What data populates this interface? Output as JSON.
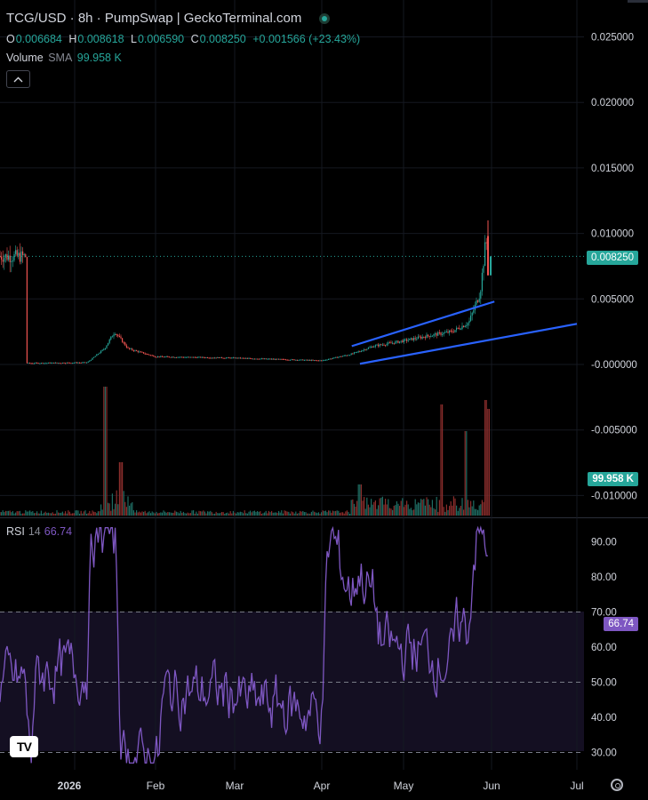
{
  "header": {
    "title": "TCG/USD · 8h · PumpSwap | GeckoTerminal.com",
    "ohlc": [
      {
        "key": "O",
        "value": "0.006684"
      },
      {
        "key": "H",
        "value": "0.008618"
      },
      {
        "key": "L",
        "value": "0.006590"
      },
      {
        "key": "C",
        "value": "0.008250"
      }
    ],
    "change": "+0.001566 (+23.43%)",
    "volume_label": "Volume",
    "volume_sma": "SMA",
    "volume_value": "99.958 K",
    "collapse_icon": "chevron-up-icon"
  },
  "rsi_header": {
    "label": "RSI",
    "period": "14",
    "value": "66.74"
  },
  "price_tag": "0.008250",
  "volume_tag": "99.958 K",
  "rsi_tag": "66.74",
  "colors": {
    "up": "#26a69a",
    "down": "#ef5350",
    "rsi": "#7e57c2",
    "trendline": "#2962ff"
  },
  "chart_data": {
    "type": "candlestick",
    "title": "TCG/USD · 8h · PumpSwap | GeckoTerminal.com",
    "x_ticks": [
      "2026",
      "Feb",
      "Mar",
      "Apr",
      "May",
      "Jun",
      "Jul"
    ],
    "y_ticks_price": [
      "0.025000",
      "0.020000",
      "0.015000",
      "0.010000",
      "0.005000",
      "-0.000000",
      "-0.005000",
      "-0.010000"
    ],
    "y_ticks_rsi": [
      "90.00",
      "80.00",
      "70.00",
      "60.00",
      "50.00",
      "40.00",
      "30.00"
    ],
    "last_price": 0.00825,
    "price_path": [
      [
        "Dec 20",
        0.0001
      ],
      [
        "Jan 12",
        0.00015
      ],
      [
        "Jan 17",
        0.0012
      ],
      [
        "Jan 20",
        0.0025
      ],
      [
        "Jan 24",
        0.0012
      ],
      [
        "Feb 1",
        0.0006
      ],
      [
        "Mar 1",
        0.0005
      ],
      [
        "Apr 1",
        0.0003
      ],
      [
        "Apr 12",
        0.0008
      ],
      [
        "Apr 20",
        0.0014
      ],
      [
        "May 1",
        0.0018
      ],
      [
        "May 10",
        0.0022
      ],
      [
        "May 18",
        0.0025
      ],
      [
        "May 24",
        0.0032
      ],
      [
        "May 28",
        0.0055
      ],
      [
        "May 30",
        0.0095
      ],
      [
        "May 31",
        0.00825
      ]
    ],
    "price_high": 0.011,
    "volume_last": "99.958 K",
    "rsi_last": 66.74,
    "rsi_levels": [
      70,
      50,
      30
    ],
    "trendlines": [
      {
        "from": [
          "Apr 12",
          0.0014
        ],
        "to": [
          "Jun 2",
          0.0048
        ]
      },
      {
        "from": [
          "Apr 15",
          5e-05
        ],
        "to": [
          "Jul 1",
          0.0031
        ]
      }
    ]
  }
}
